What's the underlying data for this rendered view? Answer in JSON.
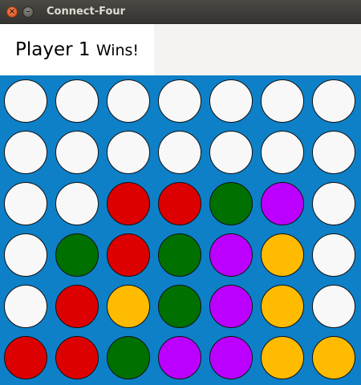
{
  "window": {
    "title": "Connect-Four",
    "close_icon": "close-icon",
    "minimize_icon": "minimize-icon",
    "close_glyph": "×",
    "minimize_glyph": "–"
  },
  "status": {
    "player": "Player 1",
    "result": "Wins!"
  },
  "colors": {
    "board": "#0d80c8",
    "empty": "#f8f8f8",
    "red": "#dd0000",
    "green": "#007000",
    "purple": "#bb00ff",
    "yellow": "#ffbb00"
  },
  "board": {
    "columns": 7,
    "rows": 6,
    "cells": [
      [
        "empty",
        "empty",
        "empty",
        "empty",
        "empty",
        "empty",
        "empty"
      ],
      [
        "empty",
        "empty",
        "empty",
        "empty",
        "empty",
        "empty",
        "empty"
      ],
      [
        "empty",
        "empty",
        "red",
        "red",
        "green",
        "purple",
        "empty"
      ],
      [
        "empty",
        "green",
        "red",
        "green",
        "purple",
        "yellow",
        "empty"
      ],
      [
        "empty",
        "red",
        "yellow",
        "green",
        "purple",
        "yellow",
        "empty"
      ],
      [
        "red",
        "red",
        "green",
        "purple",
        "purple",
        "yellow",
        "yellow"
      ]
    ]
  }
}
